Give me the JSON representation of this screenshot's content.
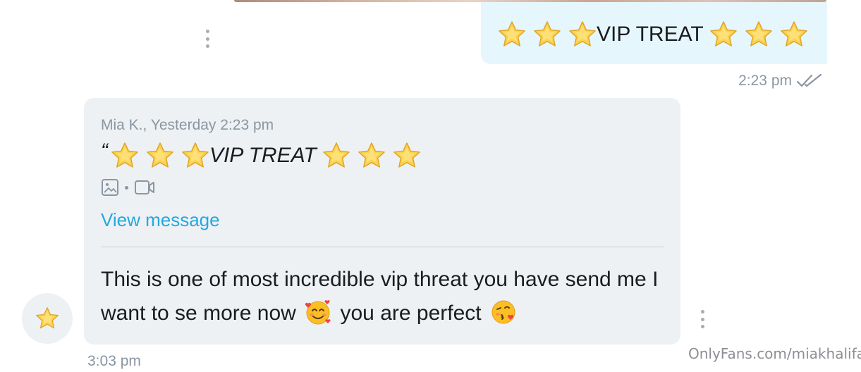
{
  "sent_message": {
    "text": "VIP TREAT",
    "stars_before": 3,
    "stars_after": 3,
    "time": "2:23 pm",
    "status_icon": "double-check-icon"
  },
  "received_message": {
    "quote_author": "Mia K., Yesterday 2:23 pm",
    "quote_mark": "“",
    "quote_text": "VIP TREAT",
    "quote_icons": [
      "image-icon",
      "video-icon"
    ],
    "view_link": "View message",
    "reply_part1": "This is one of most incredible vip threat you have send me I want to se more now",
    "reply_part2": "you are perfect",
    "time": "3:03 pm",
    "avatar_icon": "star-icon"
  },
  "watermark": "OnlyFans.com/miakhalifa",
  "colors": {
    "sent_bubble": "#e6f6fd",
    "received_bubble": "#eef1f3",
    "link": "#24a8e0",
    "meta_text": "#8a96a3",
    "body_text": "#1b1c1e"
  }
}
